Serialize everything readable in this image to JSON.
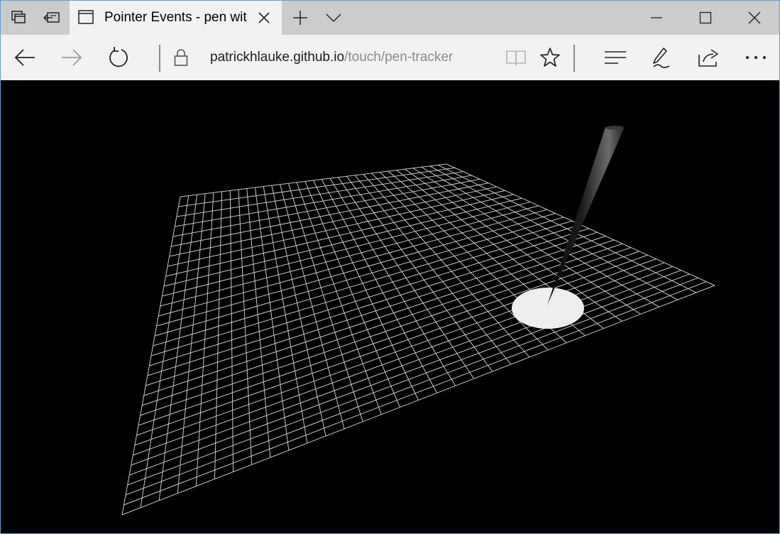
{
  "browser": {
    "tab": {
      "title": "Pointer Events - pen wit"
    },
    "address": {
      "host": "patrickhlauke.github.io",
      "path": "/touch/pen-tracker"
    }
  },
  "icons": [
    "tab-manager-icon",
    "set-aside-tabs-icon",
    "page-icon",
    "close-tab-icon",
    "new-tab-icon",
    "tab-preview-chevron-icon",
    "minimize-icon",
    "maximize-icon",
    "close-window-icon",
    "back-arrow-icon",
    "forward-arrow-icon",
    "refresh-icon",
    "lock-icon",
    "reading-view-icon",
    "favorite-star-icon",
    "hub-icon",
    "web-note-pen-icon",
    "share-icon",
    "more-ellipsis-icon"
  ],
  "colors": {
    "tabbar": "#cccccc",
    "toolbar": "#f2f2f2",
    "canvas": "#000000",
    "grid": "#c8c8c8",
    "contact": "#eeeeee"
  },
  "scene": {
    "grid_cells": 32,
    "pen": "dark stylus touching grid"
  }
}
